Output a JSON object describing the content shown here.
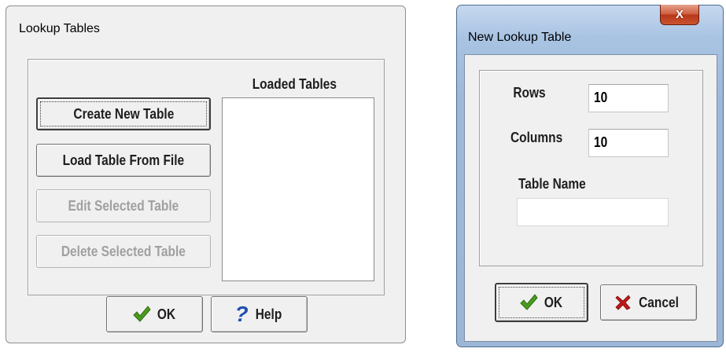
{
  "lookup_tables": {
    "title": "Lookup Tables",
    "loaded_tables_label": "Loaded Tables",
    "loaded_tables_items": [],
    "buttons": {
      "create": "Create New Table",
      "load": "Load Table From File",
      "edit": "Edit Selected Table",
      "delete": "Delete Selected Table",
      "ok": "OK",
      "help": "Help"
    },
    "icons": {
      "ok": "checkmark-icon",
      "help": "question-mark-icon"
    }
  },
  "new_lookup_table": {
    "title": "New Lookup Table",
    "close_glyph": "X",
    "rows_label": "Rows",
    "rows_value": "10",
    "columns_label": "Columns",
    "columns_value": "10",
    "table_name_label": "Table Name",
    "table_name_value": "",
    "buttons": {
      "ok": "OK",
      "cancel": "Cancel"
    },
    "icons": {
      "ok": "checkmark-icon",
      "cancel": "x-mark-icon",
      "close": "close-icon"
    }
  },
  "colors": {
    "check_green": "#4a9a1f",
    "help_blue": "#1f4fb0",
    "cancel_red": "#c01818",
    "close_red": "#c9552f"
  }
}
